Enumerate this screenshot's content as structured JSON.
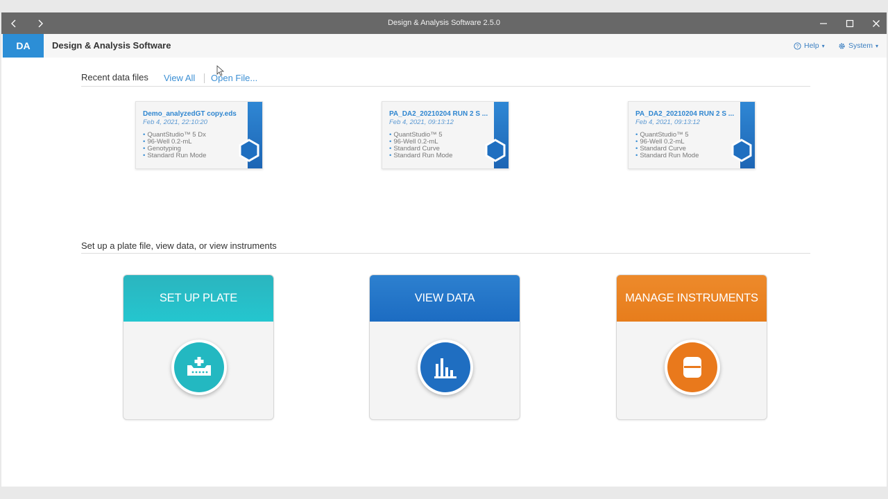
{
  "window": {
    "title": "Design & Analysis Software 2.5.0",
    "back_icon": "chevron-left-icon",
    "forward_icon": "chevron-right-icon"
  },
  "appbar": {
    "logo": "DA",
    "app_name": "Design & Analysis Software",
    "help_label": "Help",
    "system_label": "System"
  },
  "recent": {
    "label": "Recent data files",
    "view_all": "View All",
    "open_file": "Open File...",
    "files": [
      {
        "name": "Demo_analyzedGT copy.eds",
        "date": "Feb 4, 2021, 22:10:20",
        "details": [
          "QuantStudio™ 5 Dx",
          "96-Well 0.2-mL",
          "Genotyping",
          "Standard Run Mode"
        ]
      },
      {
        "name": "PA_DA2_20210204 RUN 2 S ...",
        "date": "Feb 4, 2021, 09:13:12",
        "details": [
          "QuantStudio™ 5",
          "96-Well 0.2-mL",
          "Standard Curve",
          "Standard Run Mode"
        ]
      },
      {
        "name": "PA_DA2_20210204 RUN 2 S ...",
        "date": "Feb 4, 2021, 09:13:12",
        "details": [
          "QuantStudio™ 5",
          "96-Well 0.2-mL",
          "Standard Curve",
          "Standard Run Mode"
        ]
      }
    ]
  },
  "setup": {
    "label": "Set up a plate file, view data, or view instruments",
    "tiles": [
      {
        "label": "SET UP PLATE",
        "icon": "plate-add-icon",
        "color_top": "#2bb5bf",
        "color_bottom": "#24c6cf"
      },
      {
        "label": "VIEW DATA",
        "icon": "bar-chart-icon",
        "color_top": "#2d80cf",
        "color_bottom": "#1c6cc2"
      },
      {
        "label": "MANAGE INSTRUMENTS",
        "icon": "instrument-icon",
        "color_top": "#ed8a2b",
        "color_bottom": "#e77d1c"
      }
    ]
  },
  "colors": {
    "accent": "#2c8ed6",
    "titlebar": "#686868",
    "link": "#3b8fd4"
  }
}
